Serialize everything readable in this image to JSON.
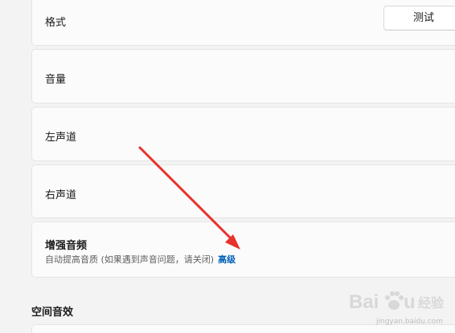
{
  "settings": {
    "format": {
      "label": "格式",
      "test_button": "测试"
    },
    "volume": {
      "label": "音量"
    },
    "left_channel": {
      "label": "左声道"
    },
    "right_channel": {
      "label": "右声道"
    },
    "enhance_audio": {
      "label": "增强音频",
      "description": "自动提高音质 (如果遇到声音问题，请关闭)",
      "advanced_link": "高级"
    },
    "spatial_audio": {
      "heading": "空间音效"
    }
  },
  "watermark": {
    "brand": "Bai du 经验",
    "url": "jingyan.baidu.com"
  },
  "colors": {
    "accent_link": "#0060b8",
    "arrow": "#e8322b",
    "page_bg": "#f3f3f3",
    "card_bg": "#fbfbfb"
  }
}
